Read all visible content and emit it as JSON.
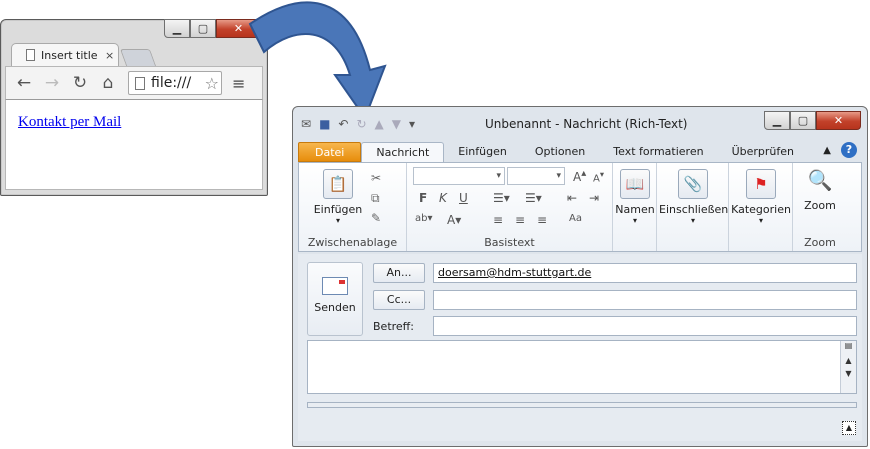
{
  "browser": {
    "tab_title": "Insert title",
    "tab_close": "×",
    "url": "file:///",
    "link_text": "Kontakt per Mail",
    "icons": [
      "back-arrow-icon",
      "forward-arrow-icon",
      "reload-icon",
      "home-icon",
      "star-icon",
      "menu-icon"
    ]
  },
  "outlook": {
    "title": "Unbenannt  -  Nachricht (Rich-Text)",
    "tabs": [
      "Datei",
      "Nachricht",
      "Einfügen",
      "Optionen",
      "Text formatieren",
      "Überprüfen"
    ],
    "help": "?",
    "groups": {
      "clipboard": {
        "paste_label": "Einfügen",
        "label": "Zwischenablage"
      },
      "basic_text": {
        "label": "Basistext"
      },
      "names": {
        "label": "Namen"
      },
      "include": {
        "label": "Einschließen"
      },
      "categories": {
        "label": "Kategorien"
      },
      "zoom": {
        "btn_label": "Zoom",
        "label": "Zoom"
      }
    },
    "compose": {
      "send_label": "Senden",
      "to_label": "An...",
      "cc_label": "Cc...",
      "subject_label": "Betreff:",
      "to_value": "doersam@hdm-stuttgart.de",
      "cc_value": "",
      "subject_value": ""
    }
  },
  "colors": {
    "file_tab": "#e78d0c",
    "close_button": "#c2412a",
    "arrow": "#4a76b8",
    "help": "#2f6fc4"
  }
}
